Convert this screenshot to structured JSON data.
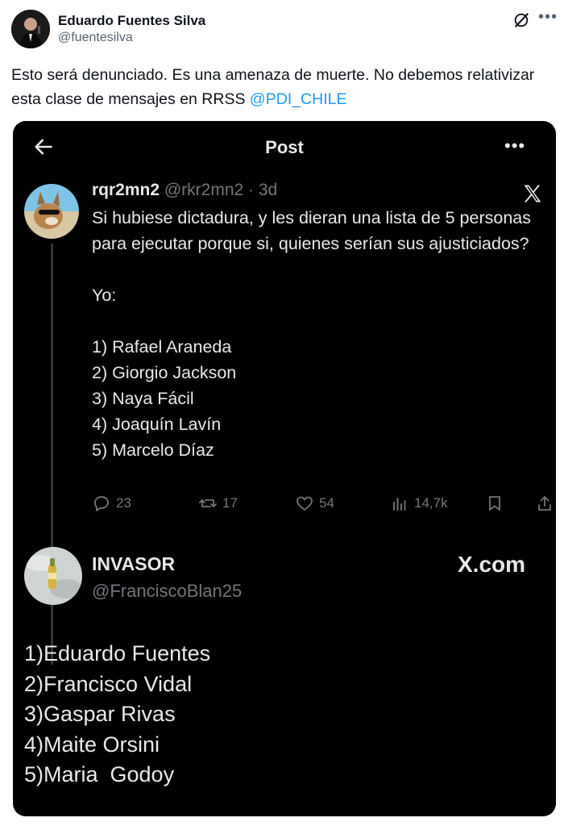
{
  "outer": {
    "author_name": "Eduardo Fuentes Silva",
    "author_handle": "@fuentesilva",
    "text_before": "Esto será denunciado. Es una amenaza de muerte. No debemos relativizar esta clase de mensajes en RRSS ",
    "mention": "@PDI_CHILE",
    "icons": [
      "grok-icon",
      "more-icon"
    ]
  },
  "embed": {
    "title": "Post",
    "more": "•••",
    "original": {
      "name": "rqr2mn2",
      "handle_meta": "@rkr2mn2 · 3d",
      "lines": [
        "Si hubiese dictadura, y les dieran una lista de 5 personas para ejecutar porque si, quienes serían sus ajusticiados?",
        "Yo:",
        "1) Rafael Araneda",
        "2) Giorgio Jackson",
        "3) Naya Fácil",
        "4) Joaquín Lavín",
        "5) Marcelo Díaz"
      ],
      "actions": {
        "replies": "23",
        "reposts": "17",
        "likes": "54",
        "views": "14,7k"
      }
    },
    "reply": {
      "name": "INVASOR",
      "handle": "@FranciscoBlan25",
      "watermark": "X.com",
      "list": [
        "1)Eduardo Fuentes",
        "2)Francisco Vidal",
        "3)Gaspar Rivas",
        "4)Maite Orsini",
        "5)Maria  Godoy"
      ]
    }
  },
  "colors": {
    "link": "#1d9bf0",
    "dark_bg": "#000000",
    "muted_dark": "#71767b",
    "muted_light": "#536471"
  }
}
